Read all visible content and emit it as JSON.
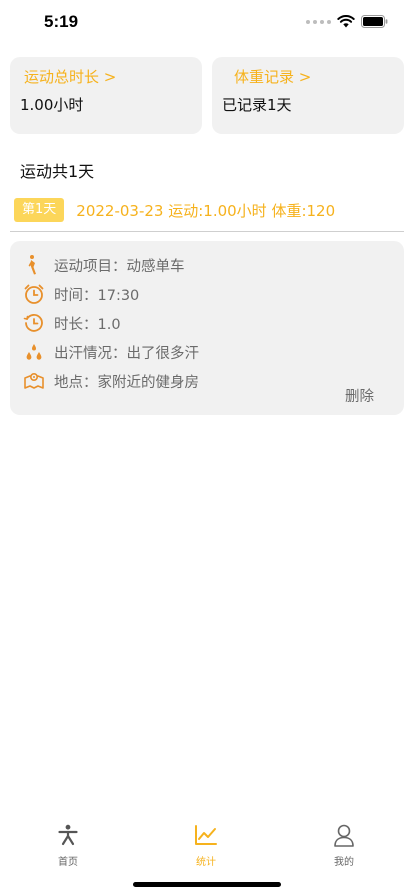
{
  "status_bar": {
    "time": "5:19"
  },
  "summary": {
    "exercise_total": {
      "title": "运动总时长 >",
      "value": "1.00小时"
    },
    "weight_record": {
      "title": "体重记录 >",
      "value": "已记录1天"
    }
  },
  "total_days": "运动共1天",
  "day_entry": {
    "badge": "第1天",
    "summary": "2022-03-23  运动:1.00小时 体重:120"
  },
  "record": {
    "rows": [
      {
        "icon": "running-person-icon",
        "text": "运动项目：动感单车"
      },
      {
        "icon": "alarm-clock-icon",
        "text": "时间：17:30"
      },
      {
        "icon": "clock-history-icon",
        "text": "时长：1.0"
      },
      {
        "icon": "water-drops-icon",
        "text": "出汗情况：出了很多汗"
      },
      {
        "icon": "map-location-icon",
        "text": "地点：家附近的健身房"
      }
    ],
    "delete_label": "删除"
  },
  "tab_bar": {
    "tabs": [
      {
        "label": "首页",
        "icon": "exercise-person-icon",
        "active": false
      },
      {
        "label": "统计",
        "icon": "line-chart-icon",
        "active": true
      },
      {
        "label": "我的",
        "icon": "user-profile-icon",
        "active": false
      }
    ]
  },
  "colors": {
    "accent": "#f6b21d",
    "badge": "#fcd65a",
    "card_background": "#f1f1f1",
    "muted_text": "#6b6b6b",
    "icon": "#e8902c"
  }
}
